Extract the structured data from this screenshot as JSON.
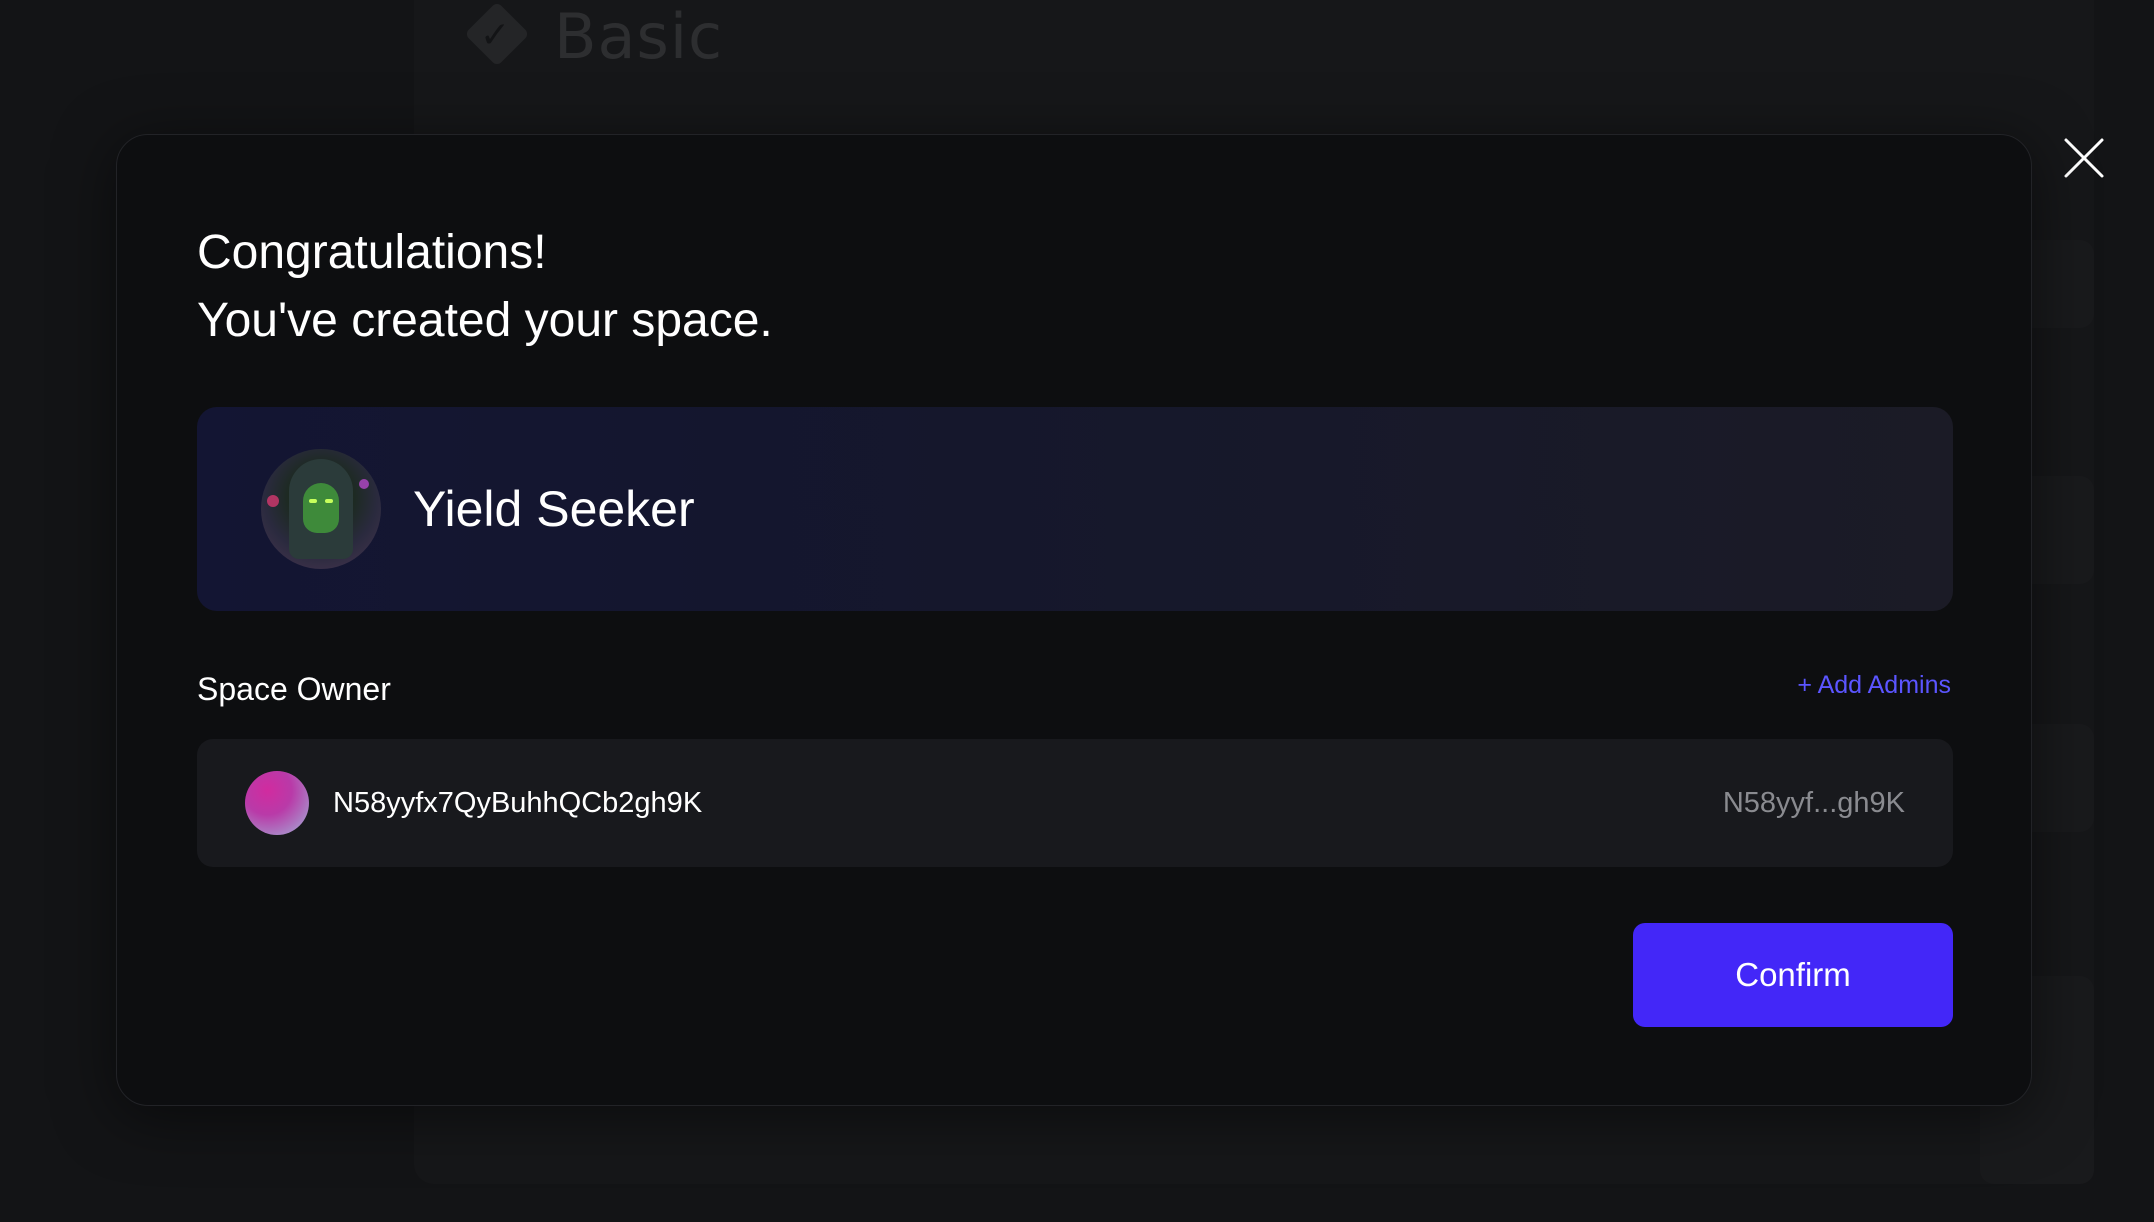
{
  "background": {
    "title": "Basic"
  },
  "modal": {
    "heading_line1": "Congratulations!",
    "heading_line2": "You've created your space.",
    "space": {
      "name": "Yield Seeker"
    },
    "owner": {
      "label": "Space Owner",
      "add_admins": "+ Add Admins",
      "address": "N58yyfx7QyBuhhQCb2gh9K",
      "short_address": "N58yyf...gh9K"
    },
    "confirm_label": "Confirm"
  },
  "colors": {
    "accent": "#4327f8",
    "link": "#5b55ff",
    "modal_bg": "#0d0e10",
    "card_bg": "#18191d"
  },
  "icons": {
    "close": "close-icon",
    "check": "check-diamond-icon"
  }
}
